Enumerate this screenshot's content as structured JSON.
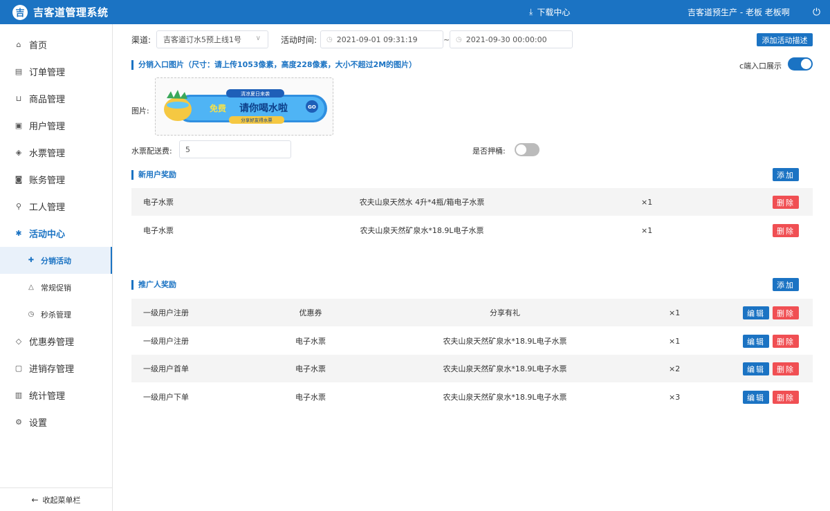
{
  "header": {
    "brand_icon": "吉",
    "brand": "吉客道管理系统",
    "download_label": "下载中心",
    "user_label": "吉客道预生产 - 老板  老板啊",
    "color": "#1b73c3"
  },
  "sidebar": {
    "items": [
      {
        "label": "首页",
        "icon": "home-icon"
      },
      {
        "label": "订单管理",
        "icon": "order-icon"
      },
      {
        "label": "商品管理",
        "icon": "basket-icon"
      },
      {
        "label": "用户管理",
        "icon": "user-card-icon"
      },
      {
        "label": "水票管理",
        "icon": "ticket-icon"
      },
      {
        "label": "账务管理",
        "icon": "money-icon"
      },
      {
        "label": "工人管理",
        "icon": "scooter-icon"
      },
      {
        "label": "活动中心",
        "icon": "gift-icon"
      }
    ],
    "sub_items": [
      {
        "label": "分销活动",
        "icon": "user-plus-icon"
      },
      {
        "label": "常规促销",
        "icon": "promo-icon"
      },
      {
        "label": "秒杀管理",
        "icon": "clock-icon"
      }
    ],
    "items_after": [
      {
        "label": "优惠券管理",
        "icon": "coupon-icon"
      },
      {
        "label": "进销存管理",
        "icon": "inventory-icon"
      },
      {
        "label": "统计管理",
        "icon": "bar-chart-icon"
      },
      {
        "label": "设置",
        "icon": "gear-icon"
      }
    ],
    "collapse_label": "收起菜单栏"
  },
  "filters": {
    "channel_label": "渠道:",
    "channel_value": "吉客道订水5预上线1号",
    "time_label": "活动时间:",
    "start_time": "2021-09-01 09:31:19",
    "tilde": "~",
    "end_time": "2021-09-30 00:00:00",
    "add_desc_label": "添加活动描述"
  },
  "entry": {
    "title": "分销入口图片（尺寸：请上传1053像素，高度228像素，大小不超过2M的图片）",
    "toggle_label": "c端入口展示",
    "toggle_on": true,
    "image_label": "图片:",
    "banner": {
      "top": "清凉夏日来袭",
      "free": "免费",
      "main": "请你喝水啦",
      "go": "GO",
      "bottom": "分享好友得水票"
    },
    "fee_label": "水票配送费:",
    "fee_value": "5",
    "bucket_label": "是否押桶:",
    "bucket_on": false
  },
  "new_user": {
    "title": "新用户奖励",
    "add_label": "添加",
    "delete_label": "删除",
    "rows": [
      {
        "type": "电子水票",
        "name": "农夫山泉天然水 4升*4瓶/箱电子水票",
        "qty": "×1"
      },
      {
        "type": "电子水票",
        "name": "农夫山泉天然矿泉水*18.9L电子水票",
        "qty": "×1"
      }
    ]
  },
  "promoter": {
    "title": "推广人奖励",
    "add_label": "添加",
    "edit_label": "编辑",
    "delete_label": "删除",
    "rows": [
      {
        "cond": "一级用户注册",
        "type": "优惠券",
        "name": "分享有礼",
        "qty": "×1"
      },
      {
        "cond": "一级用户注册",
        "type": "电子水票",
        "name": "农夫山泉天然矿泉水*18.9L电子水票",
        "qty": "×1"
      },
      {
        "cond": "一级用户首单",
        "type": "电子水票",
        "name": "农夫山泉天然矿泉水*18.9L电子水票",
        "qty": "×2"
      },
      {
        "cond": "一级用户下单",
        "type": "电子水票",
        "name": "农夫山泉天然矿泉水*18.9L电子水票",
        "qty": "×3"
      }
    ]
  }
}
